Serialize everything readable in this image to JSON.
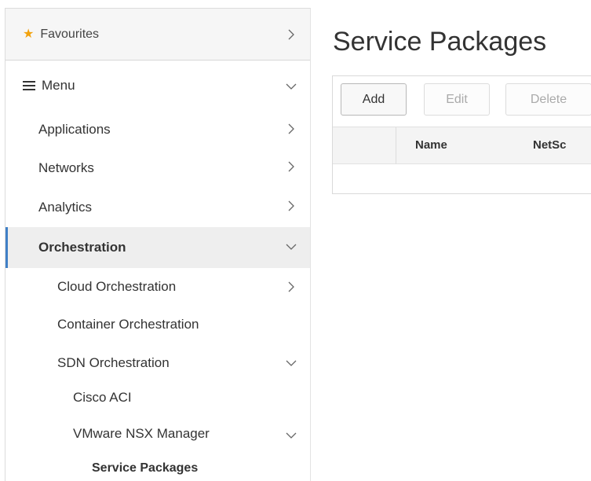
{
  "sidebar": {
    "favourites_label": "Favourites",
    "menu_label": "Menu",
    "items": {
      "applications": "Applications",
      "networks": "Networks",
      "analytics": "Analytics",
      "orchestration": "Orchestration",
      "cloud_orchestration": "Cloud Orchestration",
      "container_orchestration": "Container Orchestration",
      "sdn_orchestration": "SDN Orchestration",
      "cisco_aci": "Cisco ACI",
      "vmware_nsx_manager": "VMware NSX Manager",
      "service_packages": "Service Packages"
    },
    "active_color": "#3f7fc6",
    "star_color": "#f2a20d"
  },
  "main": {
    "title": "Service Packages",
    "toolbar": {
      "add_label": "Add",
      "edit_label": "Edit",
      "delete_label": "Delete"
    },
    "table": {
      "columns": [
        "Name",
        "NetSc"
      ]
    }
  }
}
